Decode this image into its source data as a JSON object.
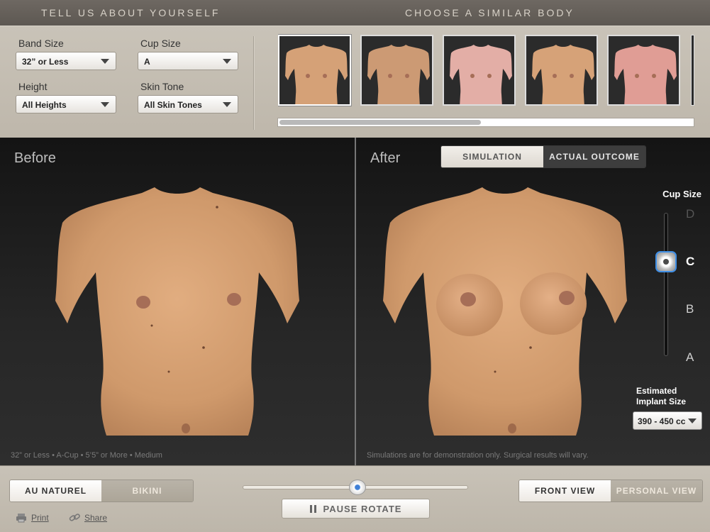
{
  "header": {
    "left_title": "TELL US ABOUT YOURSELF",
    "right_title": "CHOOSE A SIMILAR BODY"
  },
  "filters": {
    "band_size": {
      "label": "Band Size",
      "value": "32” or Less"
    },
    "cup_size": {
      "label": "Cup Size",
      "value": "A"
    },
    "height": {
      "label": "Height",
      "value": "All Heights"
    },
    "skin_tone": {
      "label": "Skin Tone",
      "value": "All Skin Tones"
    }
  },
  "thumbnails": [
    {
      "skin": "#d5a177",
      "selected": true
    },
    {
      "skin": "#cc9a74",
      "selected": false
    },
    {
      "skin": "#e3aea6",
      "selected": false
    },
    {
      "skin": "#d6a278",
      "selected": false
    },
    {
      "skin": "#e09d95",
      "selected": false
    }
  ],
  "before": {
    "title": "Before",
    "caption": "32” or Less   •   A-Cup   •   5’5” or More   •   Medium"
  },
  "after": {
    "title": "After",
    "tabs": {
      "simulation": "SIMULATION",
      "actual": "ACTUAL OUTCOME"
    },
    "cup_title": "Cup Size",
    "cup_levels": [
      "D",
      "C",
      "B",
      "A"
    ],
    "selected_cup": "C",
    "implant_title_1": "Estimated",
    "implant_title_2": "Implant Size",
    "implant_value": "390 - 450 cc",
    "disclaimer": "Simulations are for demonstration only. Surgical results will vary."
  },
  "controls": {
    "mode_on": "AU NATUREL",
    "mode_off": "BIKINI",
    "pause_label": "PAUSE ROTATE",
    "view_on": "FRONT VIEW",
    "view_off": "PERSONAL VIEW",
    "print": "Print",
    "share": "Share",
    "rotation": 0.5
  },
  "colors": {
    "skin": "#d29c6f",
    "accent": "#3f8fe6"
  }
}
